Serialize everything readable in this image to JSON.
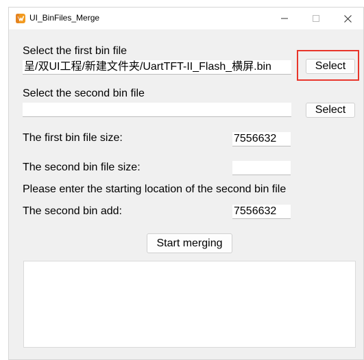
{
  "window": {
    "title": "UI_BinFiles_Merge",
    "controls": {
      "minimize": "—",
      "maximize": "☐",
      "close": "✕"
    }
  },
  "first_bin": {
    "label": "Select the first bin file",
    "path": "呈/双UI工程/新建文件夹/UartTFT-II_Flash_横屏.bin",
    "button": "Select"
  },
  "second_bin": {
    "label": "Select the second bin file",
    "path": "",
    "button": "Select"
  },
  "first_size": {
    "label": "The first bin file size:",
    "value": "7556632"
  },
  "second_size": {
    "label": "The second bin file size:",
    "value": ""
  },
  "start_location": {
    "prompt": "Please enter the starting location of the second bin file",
    "label": "The second bin add:",
    "value": "7556632"
  },
  "merge_button": "Start merging",
  "log_text": "",
  "colors": {
    "highlight": "#e8352a",
    "window_bg": "#f0f0f0"
  }
}
